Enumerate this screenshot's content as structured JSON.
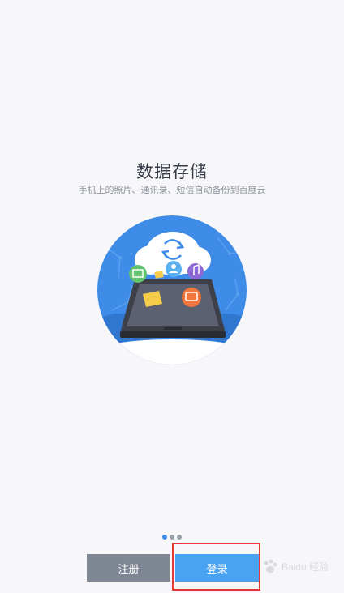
{
  "onboarding": {
    "title": "数据存储",
    "subtitle": "手机上的照片、通讯录、短信自动备份到百度云"
  },
  "pager": {
    "total": 3,
    "active_index": 0
  },
  "buttons": {
    "register_label": "注册",
    "login_label": "登录"
  },
  "colors": {
    "illustration_bg": "#3e8ce8",
    "register_button": "#7f8694",
    "login_button": "#4aa2f2",
    "highlight_box": "#e53935"
  },
  "watermark": {
    "text": "Baidu 经验"
  }
}
